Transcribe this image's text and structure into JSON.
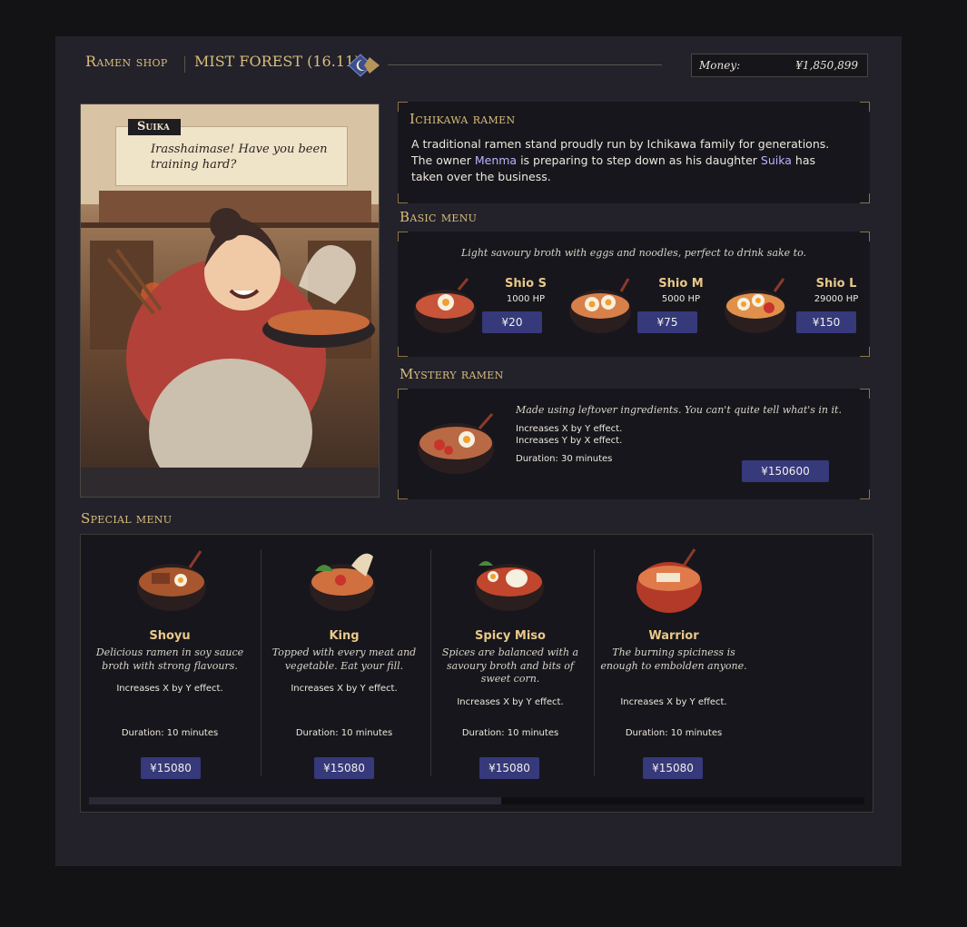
{
  "header": {
    "shop_title": "Ramen shop",
    "location": "MIST FOREST (16.11)",
    "location_icon": "moon-diamond-icon",
    "money_label": "Money:",
    "money_value": "¥1,850,899"
  },
  "portrait": {
    "speaker": "Suika",
    "dialogue": "Irasshaimase! Have you been training hard?"
  },
  "shop": {
    "name": "Ichikawa ramen",
    "desc_1": "A traditional ramen stand proudly run by Ichikawa family for generations.",
    "desc_2": "The owner",
    "owner": "Menma",
    "desc_3": "is preparing to step down as his daughter",
    "daughter": "Suika",
    "desc_4": "has taken over the business."
  },
  "basic_menu": {
    "title": "Basic menu",
    "note": "Light savoury broth with eggs and noodles, perfect to drink sake to.",
    "items": [
      {
        "name": "Shio  S",
        "hp": "1000 HP",
        "price": "¥20"
      },
      {
        "name": "Shio  M",
        "hp": "5000 HP",
        "price": "¥75"
      },
      {
        "name": "Shio  L",
        "hp": "29000 HP",
        "price": "¥150"
      }
    ]
  },
  "mystery_menu": {
    "title": "Mystery ramen",
    "note": "Made using leftover ingredients. You can't quite tell what's in it.",
    "effect_1": "Increases X by Y effect.",
    "effect_2": "Increases Y by X effect.",
    "duration": "Duration: 30 minutes",
    "price": "¥150600"
  },
  "special_menu": {
    "title": "Special menu",
    "scroll_position": 0.53,
    "items": [
      {
        "name": "Shoyu",
        "desc": "Delicious ramen in soy sauce broth with strong flavours.",
        "effect": "Increases X by Y effect.",
        "duration": "Duration: 10 minutes",
        "price": "¥15080"
      },
      {
        "name": "King",
        "desc": "Topped with every meat and vegetable. Eat your fill.",
        "effect": "Increases X by Y effect.",
        "duration": "Duration: 10 minutes",
        "price": "¥15080"
      },
      {
        "name": "Spicy Miso",
        "desc": "Spices are balanced with a savoury broth and bits of sweet corn.",
        "effect": "Increases X by Y effect.",
        "duration": "Duration: 10 minutes",
        "price": "¥15080"
      },
      {
        "name": "Warrior",
        "desc": "The burning spiciness is enough to embolden anyone.",
        "effect": "Increases X by Y effect.",
        "duration": "Duration: 10 minutes",
        "price": "¥15080"
      }
    ]
  }
}
